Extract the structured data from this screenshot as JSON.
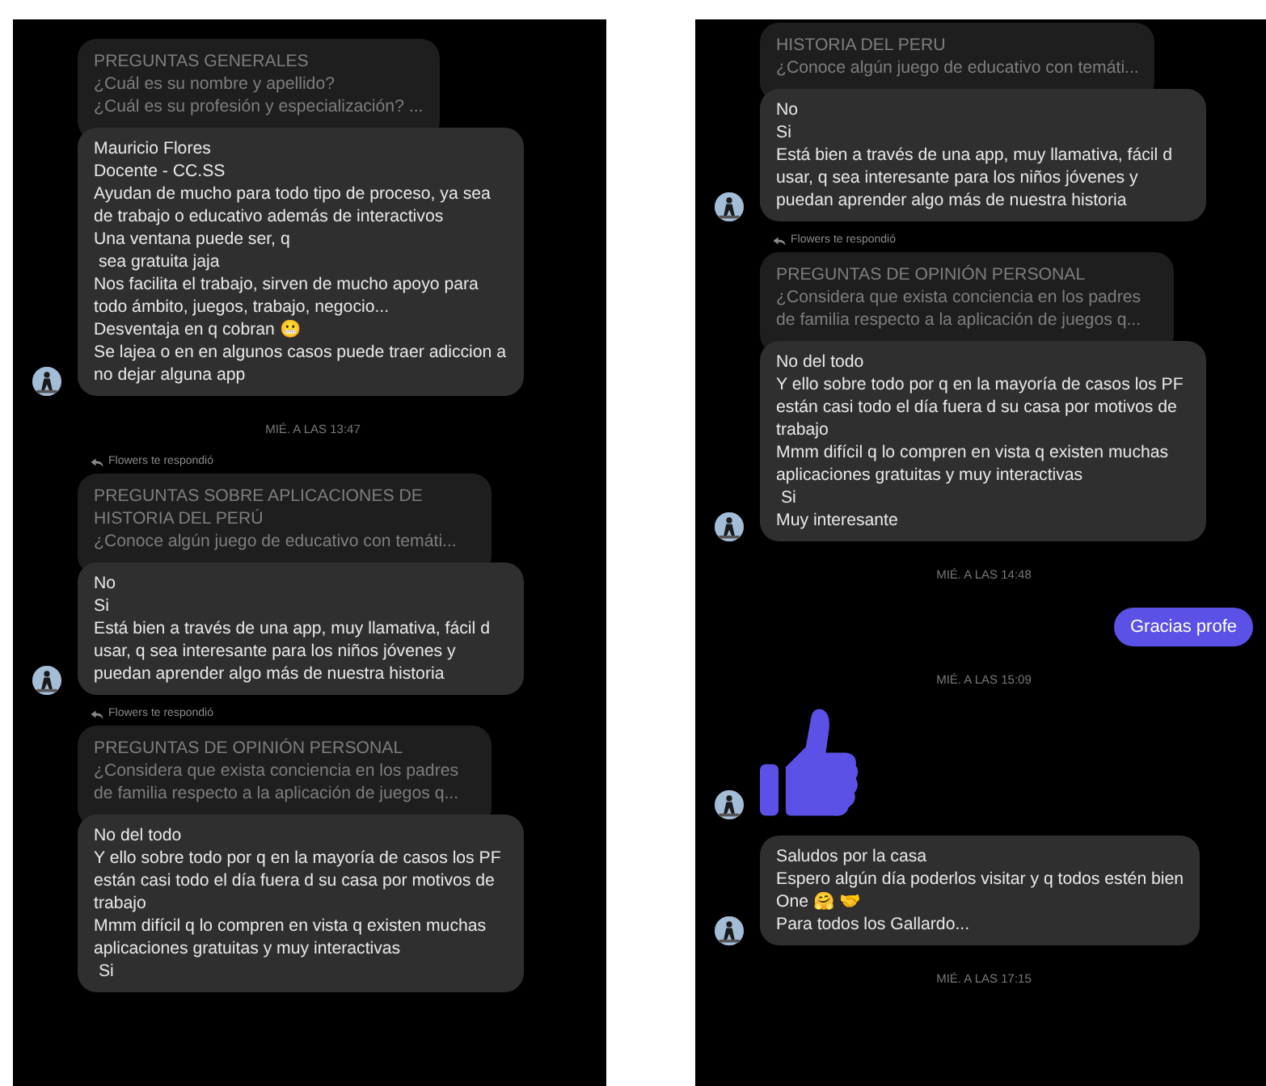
{
  "panels": [
    {
      "items": [
        {
          "kind": "message",
          "avatar": true,
          "quote": [
            "PREGUNTAS GENERALES",
            "¿Cuál es su nombre y apellido?",
            "¿Cuál es su profesión y especialización? ..."
          ],
          "lines": [
            "Mauricio Flores",
            "Docente - CC.SS",
            "Ayudan de mucho para todo tipo de proceso, ya sea de trabajo o educativo además de interactivos",
            "Una ventana puede ser, q",
            " sea gratuita jaja",
            "Nos facilita el trabajo, sirven de mucho apoyo para todo ámbito, juegos, trabajo, negocio...",
            "Desventaja en q cobran 😬",
            "Se lajea o en en algunos casos puede traer adiccion a no dejar alguna app"
          ]
        },
        {
          "kind": "timestamp",
          "text": "MIÉ. A LAS 13:47"
        },
        {
          "kind": "message",
          "avatar": true,
          "reply_label": "Flowers te respondió",
          "quote": [
            "PREGUNTAS SOBRE APLICACIONES DE HISTORIA DEL PERÚ",
            "¿Conoce algún juego de educativo con temáti..."
          ],
          "lines": [
            "No",
            "Si",
            "Está bien a través de una app, muy llamativa, fácil d usar, q sea interesante para los niños jóvenes y puedan aprender algo más de nuestra historia"
          ]
        },
        {
          "kind": "message",
          "avatar": false,
          "reply_label": "Flowers te respondió",
          "quote": [
            "PREGUNTAS DE OPINIÓN PERSONAL",
            "¿Considera que exista conciencia en los padres de familia respecto a la aplicación de juegos q..."
          ],
          "lines": [
            "No del todo",
            "Y ello sobre todo por q en la mayoría de casos los PF están casi todo el día fuera d su casa por motivos de trabajo",
            "Mmm difícil q lo compren en vista q existen muchas aplicaciones gratuitas y muy interactivas",
            " Si"
          ]
        }
      ]
    },
    {
      "items": [
        {
          "kind": "message",
          "avatar": true,
          "quote": [
            "HISTORIA DEL PERU",
            "¿Conoce algún juego de educativo con temáti..."
          ],
          "lines": [
            "No",
            "Si",
            "Está bien a través de una app, muy llamativa, fácil d usar, q sea interesante para los niños jóvenes y puedan aprender algo más de nuestra historia"
          ]
        },
        {
          "kind": "message",
          "avatar": true,
          "reply_label": "Flowers te respondió",
          "quote": [
            "PREGUNTAS DE OPINIÓN PERSONAL",
            "¿Considera que exista conciencia en los padres de familia respecto a la aplicación de juegos q..."
          ],
          "lines": [
            "No del todo",
            "Y ello sobre todo por q en la mayoría de casos los PF están casi todo el día fuera d su casa por motivos de trabajo",
            "Mmm difícil q lo compren en vista q existen muchas aplicaciones gratuitas y muy interactivas",
            " Si",
            "Muy interesante"
          ]
        },
        {
          "kind": "timestamp",
          "text": "MIÉ. A LAS 14:48"
        },
        {
          "kind": "sent",
          "text": "Gracias profe"
        },
        {
          "kind": "timestamp",
          "text": "MIÉ. A LAS 15:09"
        },
        {
          "kind": "like",
          "avatar": true
        },
        {
          "kind": "message",
          "avatar": true,
          "lines": [
            "Saludos por la casa",
            "Espero algún día poderlos visitar y q todos estén bien",
            "One 🤗 🤝",
            "Para todos los Gallardo..."
          ]
        },
        {
          "kind": "timestamp",
          "text": "MIÉ. A LAS 17:15"
        }
      ]
    }
  ]
}
